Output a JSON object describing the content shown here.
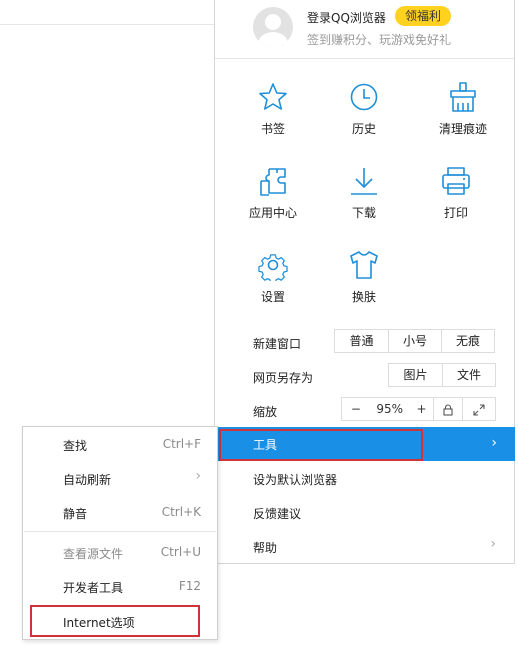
{
  "header": {
    "login_text": "登录QQ浏览器",
    "badge": "领福利",
    "subtext": "签到赚积分、玩游戏免好礼"
  },
  "grid": [
    {
      "label": "书签",
      "icon": "star-icon"
    },
    {
      "label": "历史",
      "icon": "clock-icon"
    },
    {
      "label": "清理痕迹",
      "icon": "broom-icon"
    },
    {
      "label": "应用中心",
      "icon": "puzzle-icon"
    },
    {
      "label": "下载",
      "icon": "download-icon"
    },
    {
      "label": "打印",
      "icon": "printer-icon"
    },
    {
      "label": "设置",
      "icon": "gear-icon"
    },
    {
      "label": "换肤",
      "icon": "shirt-icon"
    }
  ],
  "new_window": {
    "label": "新建窗口",
    "options": [
      "普通",
      "小号",
      "无痕"
    ]
  },
  "save_page": {
    "label": "网页另存为",
    "options": [
      "图片",
      "文件"
    ]
  },
  "zoom": {
    "label": "缩放",
    "minus": "−",
    "value": "95%",
    "plus": "+"
  },
  "menu": {
    "tools": "工具",
    "default_browser": "设为默认浏览器",
    "feedback": "反馈建议",
    "help": "帮助"
  },
  "submenu": {
    "items": [
      {
        "label": "查找",
        "shortcut": "Ctrl+F"
      },
      {
        "label": "自动刷新",
        "shortcut": ""
      },
      {
        "label": "静音",
        "shortcut": "Ctrl+K"
      },
      {
        "label": "查看源文件",
        "shortcut": "Ctrl+U"
      },
      {
        "label": "开发者工具",
        "shortcut": "F12"
      },
      {
        "label": "Internet选项",
        "shortcut": ""
      }
    ]
  },
  "colors": {
    "accent": "#1a8fe6",
    "icon": "#1e8fd9",
    "highlight_box": "#d0323a",
    "badge": "#ffd21f"
  }
}
